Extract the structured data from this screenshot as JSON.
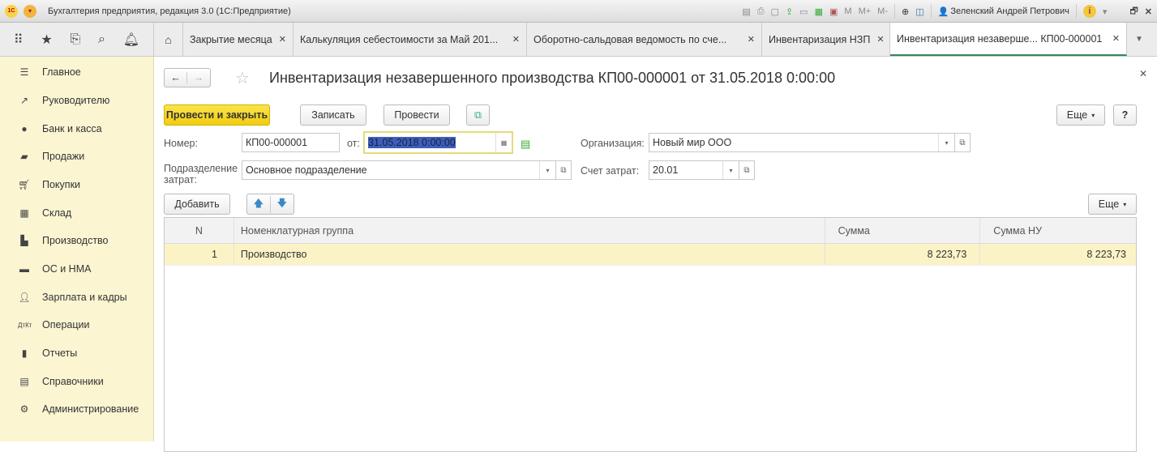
{
  "app": {
    "title": "Бухгалтерия предприятия, редакция 3.0  (1С:Предприятие)",
    "user": "Зеленский Андрей Петрович",
    "toolbar_letters": [
      "M",
      "M+",
      "M-"
    ]
  },
  "tabs": [
    {
      "label": "Закрытие месяца"
    },
    {
      "label": "Калькуляция себестоимости за Май 201..."
    },
    {
      "label": "Оборотно-сальдовая ведомость по сче..."
    },
    {
      "label": "Инвентаризация НЗП"
    },
    {
      "label": "Инвентаризация незаверше... КП00-000001",
      "active": true
    }
  ],
  "sidebar": {
    "items": [
      {
        "label": "Главное",
        "icon": "menu-icon"
      },
      {
        "label": "Руководителю",
        "icon": "trend-icon"
      },
      {
        "label": "Банк и касса",
        "icon": "coin-icon"
      },
      {
        "label": "Продажи",
        "icon": "bag-icon"
      },
      {
        "label": "Покупки",
        "icon": "cart-icon"
      },
      {
        "label": "Склад",
        "icon": "warehouse-icon"
      },
      {
        "label": "Производство",
        "icon": "factory-icon"
      },
      {
        "label": "ОС и НМА",
        "icon": "truck-icon"
      },
      {
        "label": "Зарплата и кадры",
        "icon": "person-icon"
      },
      {
        "label": "Операции",
        "icon": "dt-kt-icon"
      },
      {
        "label": "Отчеты",
        "icon": "chart-icon"
      },
      {
        "label": "Справочники",
        "icon": "book-icon"
      },
      {
        "label": "Администрирование",
        "icon": "gear-icon"
      }
    ]
  },
  "document": {
    "title": "Инвентаризация незавершенного производства КП00-000001 от 31.05.2018 0:00:00",
    "buttons": {
      "post_close": "Провести и закрыть",
      "save": "Записать",
      "post": "Провести",
      "more": "Еще",
      "help": "?",
      "add": "Добавить",
      "table_more": "Еще"
    },
    "fields": {
      "number_label": "Номер:",
      "number": "КП00-000001",
      "date_label": "от:",
      "date": "31.05.2018  0:00:00",
      "org_label": "Организация:",
      "org": "Новый мир ООО",
      "dept_label": "Подразделение затрат:",
      "dept": "Основное подразделение",
      "account_label": "Счет затрат:",
      "account": "20.01"
    },
    "table": {
      "columns": [
        "N",
        "Номенклатурная группа",
        "Сумма",
        "Сумма НУ"
      ],
      "rows": [
        {
          "n": "1",
          "group": "Производство",
          "sum": "8 223,73",
          "sum_nu": "8 223,73"
        }
      ]
    }
  },
  "colors": {
    "accent": "#f1cc10",
    "sidebar": "#fbf5d2",
    "active_tab_line": "#2f8a5a",
    "selected_row": "#fbf3c6"
  }
}
